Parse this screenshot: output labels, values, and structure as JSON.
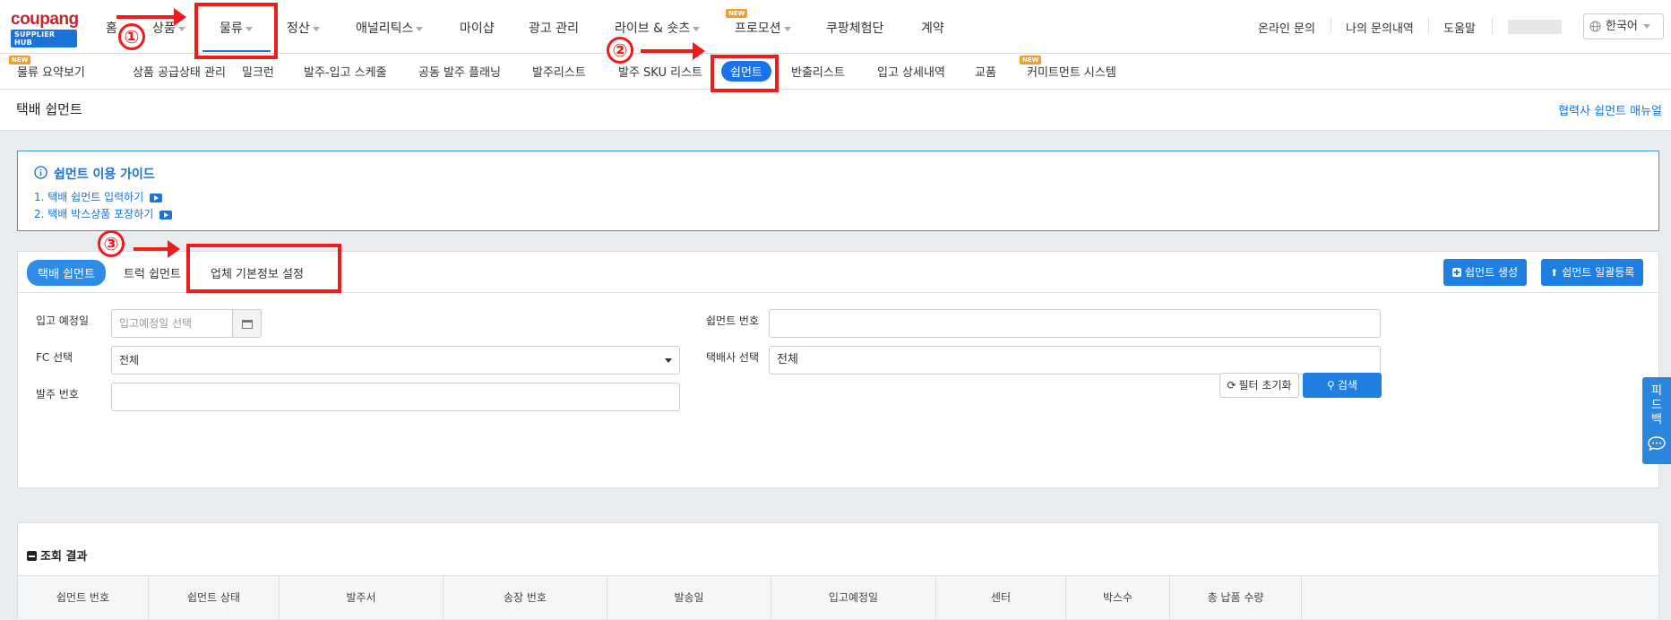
{
  "logo": {
    "brand": "coupang",
    "sub": "SUPPLIER HUB"
  },
  "main_nav": [
    "홈",
    "상품",
    "물류",
    "정산",
    "애널리틱스",
    "마이샵",
    "광고 관리",
    "라이브 & 숏츠",
    "프로모션",
    "쿠팡체험단",
    "계약"
  ],
  "new_tag": "NEW",
  "top_right": {
    "inquiry": "온라인 문의",
    "my_inquiry": "나의 문의내역",
    "help": "도움말",
    "language": "한국어"
  },
  "sub_nav": [
    "물류 요약보기",
    "상품 공급상태 관리",
    "밀크런",
    "발주-입고 스케줄",
    "공동 발주 플래닝",
    "발주리스트",
    "발주 SKU 리스트",
    "쉽먼트",
    "반출리스트",
    "입고 상세내역",
    "교품",
    "커미트먼트 시스템"
  ],
  "page": {
    "title": "택배 쉽먼트",
    "manual_link": "협력사 쉽먼트 매뉴얼"
  },
  "guide": {
    "title": "쉽먼트 이용 가이드",
    "links": [
      "1. 택배 쉽먼트 입력하기",
      "2. 택배 박스상품 포장하기"
    ]
  },
  "tabs": [
    "택배 쉽먼트",
    "트럭 쉽먼트",
    "업체 기본정보 설정"
  ],
  "actions": {
    "create": "쉽먼트 생성",
    "bulk": "쉽먼트 일괄등록"
  },
  "form": {
    "arrival_date_label": "입고 예정일",
    "arrival_date_placeholder": "입고예정일 선택",
    "shipment_no_label": "쉽먼트 번호",
    "fc_label": "FC 선택",
    "fc_value": "전체",
    "courier_label": "택배사 선택",
    "courier_value": "전체",
    "po_label": "발주 번호"
  },
  "buttons": {
    "reset": "필터 초기화",
    "search": "검색"
  },
  "result": {
    "title": "조회 결과",
    "columns": [
      "쉽먼트 번호",
      "쉽먼트 상태",
      "발주서",
      "송장 번호",
      "발송일",
      "입고예정일",
      "센터",
      "박스수",
      "총 납품 수량"
    ]
  },
  "feedback": "피드백",
  "annotations": [
    "①",
    "②",
    "③"
  ]
}
